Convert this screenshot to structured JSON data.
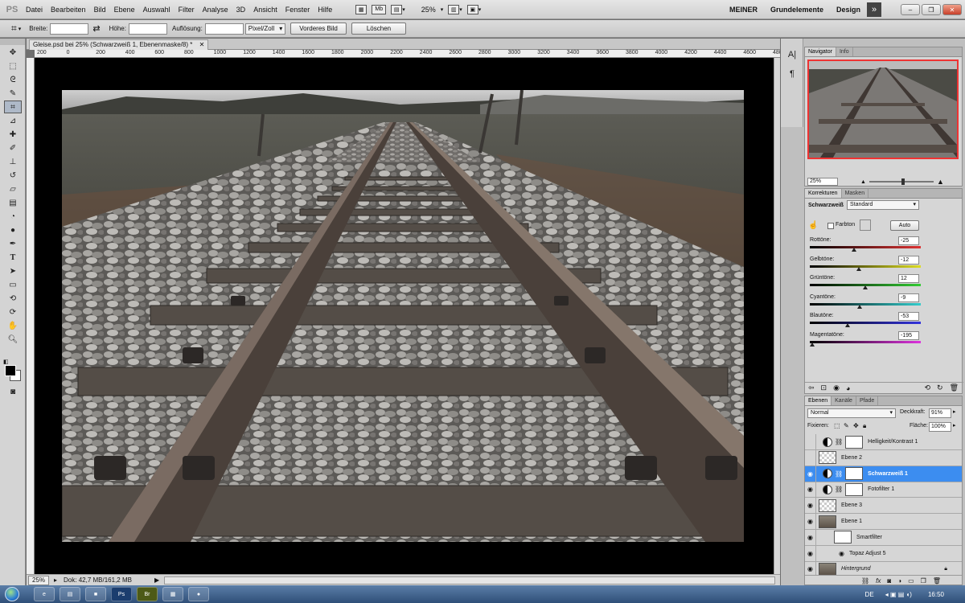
{
  "menubar": {
    "logo": "PS",
    "items": [
      "Datei",
      "Bearbeiten",
      "Bild",
      "Ebene",
      "Auswahl",
      "Filter",
      "Analyse",
      "3D",
      "Ansicht",
      "Fenster",
      "Hilfe"
    ],
    "mb_label": "Mb",
    "zoom": "25%",
    "workspaces": [
      "MEINER",
      "Grundelemente",
      "Design"
    ],
    "more": "»"
  },
  "options": {
    "width_label": "Breite:",
    "height_label": "Höhe:",
    "resolution_label": "Auflösung:",
    "unit": "Pixel/Zoll",
    "front_image_btn": "Vorderes Bild",
    "clear_btn": "Löschen"
  },
  "document": {
    "tab_title": "Gleise.psd bei 25% (Schwarzweiß 1, Ebenenmaske/8) *",
    "ruler_labels": [
      "200",
      "0",
      "200",
      "400",
      "600",
      "800",
      "1000",
      "1200",
      "1400",
      "1600",
      "1800",
      "2000",
      "2200",
      "2400",
      "2600",
      "2800",
      "3000",
      "3200",
      "3400",
      "3600",
      "3800",
      "4000",
      "4200",
      "4400",
      "4600",
      "4800"
    ],
    "status_zoom": "25%",
    "status_doc": "Dok: 42,7 MB/161,2 MB"
  },
  "navigator": {
    "tabs": [
      "Navigator",
      "Info"
    ],
    "zoom": "25%"
  },
  "adjustments": {
    "tabs": [
      "Korrekturen",
      "Masken"
    ],
    "title": "Schwarzweiß",
    "preset": "Standard",
    "tint_label": "Farbton",
    "auto_btn": "Auto",
    "sliders": [
      {
        "label": "Rottöne:",
        "value": "-25",
        "pos": 0.4,
        "grad": "#000,#d33"
      },
      {
        "label": "Gelbtöne:",
        "value": "-12",
        "pos": 0.44,
        "grad": "#000,#dd2"
      },
      {
        "label": "Grüntöne:",
        "value": "12",
        "pos": 0.5,
        "grad": "#000,#3c3"
      },
      {
        "label": "Cyantöne:",
        "value": "-9",
        "pos": 0.45,
        "grad": "#000,#3cc"
      },
      {
        "label": "Blautöne:",
        "value": "-53",
        "pos": 0.34,
        "grad": "#000,#33d"
      },
      {
        "label": "Magentatöne:",
        "value": "-195",
        "pos": 0.02,
        "grad": "#000,#d3d"
      }
    ]
  },
  "layers": {
    "tabs": [
      "Ebenen",
      "Kanäle",
      "Pfade"
    ],
    "blend": "Normal",
    "opacity_label": "Deckkraft:",
    "opacity": "91%",
    "lock_label": "Fixieren:",
    "fill_label": "Fläche:",
    "fill": "100%",
    "items": [
      {
        "name": "Helligkeit/Kontrast 1",
        "type": "adj",
        "visible": false
      },
      {
        "name": "Ebene 2",
        "type": "pixel",
        "visible": false
      },
      {
        "name": "Schwarzweiß 1",
        "type": "adj",
        "visible": true,
        "selected": true
      },
      {
        "name": "Fotofilter 1",
        "type": "adj",
        "visible": true
      },
      {
        "name": "Ebene 3",
        "type": "pixel",
        "visible": true
      },
      {
        "name": "Ebene 1",
        "type": "photo",
        "visible": true
      },
      {
        "name": "Smartfilter",
        "type": "smart",
        "visible": true
      },
      {
        "name": "Topaz Adjust 5",
        "type": "filter",
        "visible": true
      },
      {
        "name": "Hintergrund",
        "type": "photo",
        "visible": true,
        "italic": true
      }
    ]
  },
  "taskbar": {
    "lang": "DE",
    "time": "16:50",
    "apps": [
      "Ps",
      "Br"
    ]
  },
  "colors": {
    "accent": "#3c8df0",
    "nav_frame": "#e33333",
    "taskbar": "#3a5d8c"
  }
}
